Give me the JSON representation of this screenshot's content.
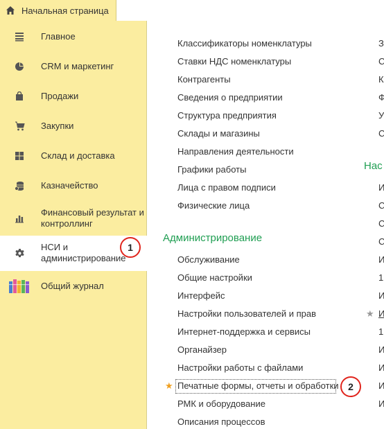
{
  "tabbar": {
    "home_tab_label": "Начальная страница"
  },
  "sidebar": {
    "items": [
      {
        "label": "Главное",
        "icon": "menu-lines-icon"
      },
      {
        "label": "CRM и маркетинг",
        "icon": "pie-chart-icon"
      },
      {
        "label": "Продажи",
        "icon": "shopping-bag-icon"
      },
      {
        "label": "Закупки",
        "icon": "cart-icon"
      },
      {
        "label": "Склад и доставка",
        "icon": "warehouse-grid-icon"
      },
      {
        "label": "Казначейство",
        "icon": "coins-icon"
      },
      {
        "label": "Финансовый результат и контроллинг",
        "label_line1": "Финансовый результат и",
        "label_line2": "контроллинг",
        "icon": "bar-chart-icon"
      },
      {
        "label": "НСИ и администрирование",
        "label_line1": "НСИ и",
        "label_line2": "администрирование",
        "icon": "gear-icon",
        "active": true
      },
      {
        "label": "Общий журнал",
        "icon": "journal-books-icon"
      }
    ]
  },
  "content": {
    "links_top": [
      "Классификаторы номенклатуры",
      "Ставки НДС номенклатуры",
      "Контрагенты",
      "Сведения о предприятии",
      "Структура предприятия",
      "Склады и магазины",
      "Направления деятельности",
      "Графики работы",
      "Лица с правом подписи",
      "Физические лица"
    ],
    "admin_section_title": "Администрирование",
    "admin_links": [
      "Обслуживание",
      "Общие настройки",
      "Интерфейс",
      "Настройки пользователей и прав",
      "Интернет-поддержка и сервисы",
      "Органайзер",
      "Настройки работы с файлами",
      "Печатные формы, отчеты и обработки",
      "РМК и оборудование",
      "Описания процессов"
    ],
    "right_section_title": "Нас",
    "right_col_letters_top": [
      "З",
      "С",
      "К",
      "Ф",
      "У",
      "С"
    ],
    "right_col_letters_bottom": [
      "И",
      "С",
      "С",
      "С",
      "И",
      "1",
      "И",
      "И",
      "1",
      "И",
      "И",
      "И",
      "И"
    ]
  },
  "annotations": {
    "badge1": "1",
    "badge2": "2"
  },
  "colors": {
    "sidebar_bg": "#fbeda0",
    "section_green": "#1f9e52",
    "badge_red": "#e0241c",
    "star_orange": "#f0a020",
    "star_gray": "#999999"
  }
}
